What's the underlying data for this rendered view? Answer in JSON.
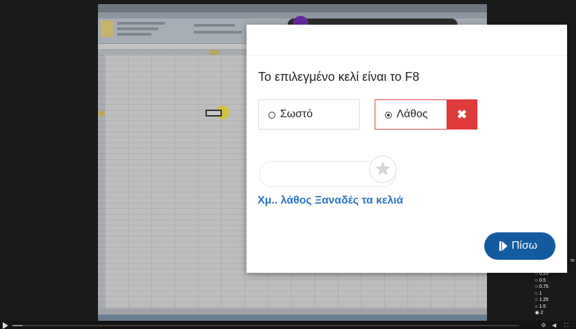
{
  "quiz": {
    "question": "Το επιλεγμένο κελί είναι το F8",
    "options": [
      {
        "label": "Σωστό",
        "selected": false
      },
      {
        "label": "Λάθος",
        "selected": true,
        "status": "wrong"
      }
    ],
    "wrong_mark": "✖",
    "feedback": "Χμ.. λάθος Ξαναδές τα κελιά",
    "back_button": "Πίσω",
    "rating_icon": "star-icon"
  },
  "player": {
    "speed_header": "te",
    "speed_options": [
      {
        "label": "0.25",
        "selected": false
      },
      {
        "label": "0.5",
        "selected": false
      },
      {
        "label": "0.75",
        "selected": false
      },
      {
        "label": "1",
        "selected": false
      },
      {
        "label": "1.25",
        "selected": false
      },
      {
        "label": "1.5",
        "selected": false
      },
      {
        "label": "2",
        "selected": true
      }
    ],
    "progress": 0.02
  },
  "colors": {
    "accent_blue": "#145a9e",
    "feedback_blue": "#2a73c4",
    "wrong_red": "#e03a3a"
  }
}
